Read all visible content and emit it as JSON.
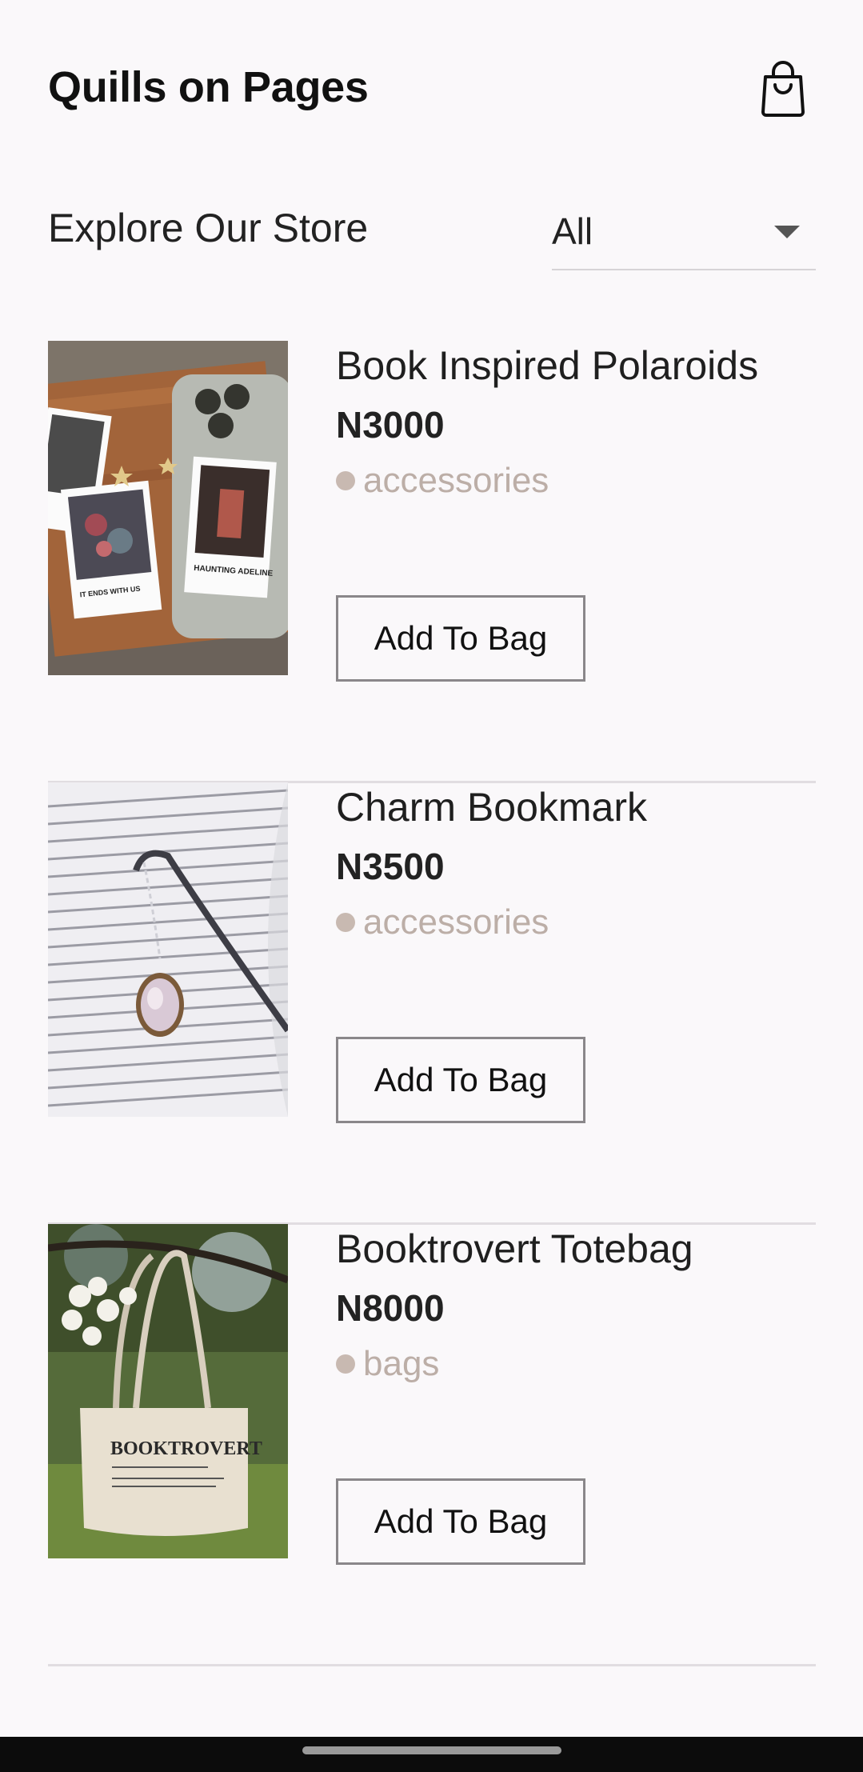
{
  "header": {
    "title": "Quills on Pages",
    "bag_icon": "shopping-bag-icon"
  },
  "explore": {
    "title": "Explore Our Store"
  },
  "filter": {
    "value": "All",
    "caret_icon": "caret-down-icon"
  },
  "products": [
    {
      "name": "Book Inspired Polaroids",
      "price": "N3000",
      "category": "accessories",
      "button": "Add To Bag"
    },
    {
      "name": "Charm Bookmark",
      "price": "N3500",
      "category": "accessories",
      "button": "Add To Bag"
    },
    {
      "name": "Booktrovert Totebag",
      "price": "N8000",
      "category": "bags",
      "button": "Add To Bag"
    }
  ],
  "images": {
    "polaroid_caption_1": "IT ENDS WITH US",
    "polaroid_caption_2": "HAUNTING ADELINE",
    "tote_text": "BOOKTROVERT"
  },
  "colors": {
    "background": "#faf8fa",
    "category_text": "#bcaea7",
    "divider": "#e1dde1",
    "button_border": "#8a878a"
  }
}
